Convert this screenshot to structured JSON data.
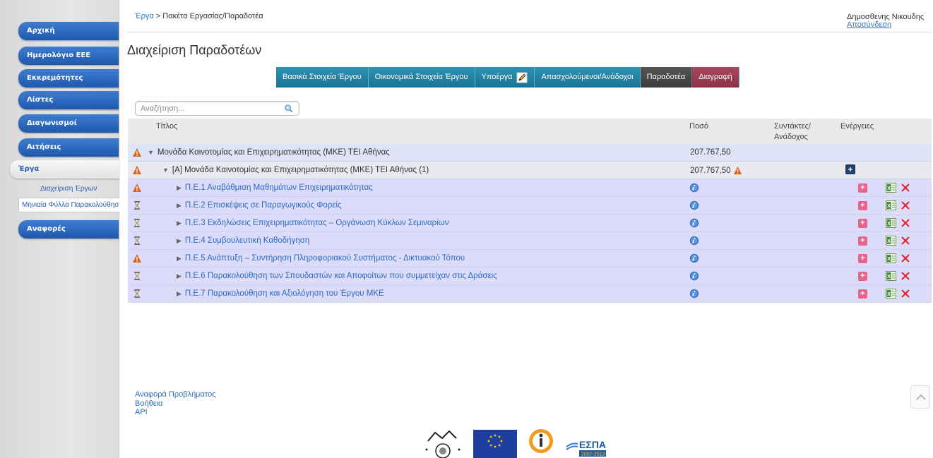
{
  "sidebar": {
    "items": [
      {
        "label": "Αρχική"
      },
      {
        "label": "Ημερολόγιο ΕΕΕ"
      },
      {
        "label": "Εκκρεμότητες"
      },
      {
        "label": "Λίστες"
      },
      {
        "label": "Διαγωνισμοί"
      },
      {
        "label": "Αιτήσεις"
      },
      {
        "label": "Έργα"
      },
      {
        "label": "Αναφορές"
      }
    ],
    "sub_items": [
      {
        "label": "Διαχείριση Έργων"
      },
      {
        "label": "Μηνιαία Φύλλα Παρακολούθησης"
      }
    ]
  },
  "breadcrumb": {
    "link": "Έργα",
    "separator": " > ",
    "current": "Πακέτα Εργασίας/Παραδοτέα"
  },
  "user": {
    "name": "Δημοσθενης Νικουδης",
    "logout": "Αποσύνδεση"
  },
  "page_title": "Διαχείριση Παραδοτέων",
  "tabs": [
    {
      "label": "Βασικά Στοιχεία Έργου"
    },
    {
      "label": "Οικονομικά Στοιχεία Έργου"
    },
    {
      "label": "Υποέργα"
    },
    {
      "label": "Απασχολούμενοι/Ανάδοχοι"
    },
    {
      "label": "Παραδοτέα"
    },
    {
      "label": "Διαγραφή"
    }
  ],
  "search": {
    "placeholder": "Αναζήτηση..."
  },
  "table": {
    "headers": {
      "title": "Τίτλος",
      "amount": "Ποσό",
      "authors": "Συντάκτες/ Ανάδοχος",
      "actions": "Ενέργειες"
    },
    "group": {
      "title": "Μονάδα Καινοτομίας και Επιχειρηματικότητας (ΜΚΕ) ΤΕΙ Αθήνας",
      "amount": "207.767,50",
      "status": "warning"
    },
    "subgroup": {
      "title": "[Α] Μονάδα Καινοτομίας και Επιχειρηματικότητας (ΜΚΕ) ΤΕΙ Αθήνας (1)",
      "amount": "207.767,50",
      "status": "warning"
    },
    "items": [
      {
        "title": "Π.Ε.1 Αναβάθμιση Μαθημάτων Επιχειρηματικότητας",
        "status": "warning"
      },
      {
        "title": "Π.Ε.2 Επισκέψεις σε Παραγωγικούς Φορείς",
        "status": "pending"
      },
      {
        "title": "Π.Ε.3 Εκδηλώσεις Επιχειρηματικότητας – Οργάνωση Κύκλων Σεμιναρίων",
        "status": "pending"
      },
      {
        "title": "Π.Ε.4 Συμβουλευτική Καθοδήγηση",
        "status": "pending"
      },
      {
        "title": "Π.Ε.5 Ανάπτυξη – Συντήρηση Πληροφοριακού Συστήματος - Δικτυακού Τόπου",
        "status": "warning"
      },
      {
        "title": "Π.Ε.6 Παρακολούθηση των Σπουδαστών και Αποφοίτων που συμμετείχαν στις Δράσεις",
        "status": "pending"
      },
      {
        "title": "Π.Ε.7 Παρακολούθηση και Αξιολόγηση του Έργου ΜΚΕ",
        "status": "pending"
      }
    ]
  },
  "footer": {
    "links": [
      {
        "label": "Αναφορά Προβλήματος"
      },
      {
        "label": "Βοήθεια"
      },
      {
        "label": "API"
      }
    ],
    "espa_logo_text": "ΕΣΠΑ",
    "espa_years": "2007-2013"
  },
  "colors": {
    "nav_blue": "#2a66bd",
    "tab_teal": "#1f809f",
    "tab_dark": "#444444",
    "tab_danger": "#9a3c52",
    "warning": "#d9641e",
    "link": "#2a6bbf"
  }
}
